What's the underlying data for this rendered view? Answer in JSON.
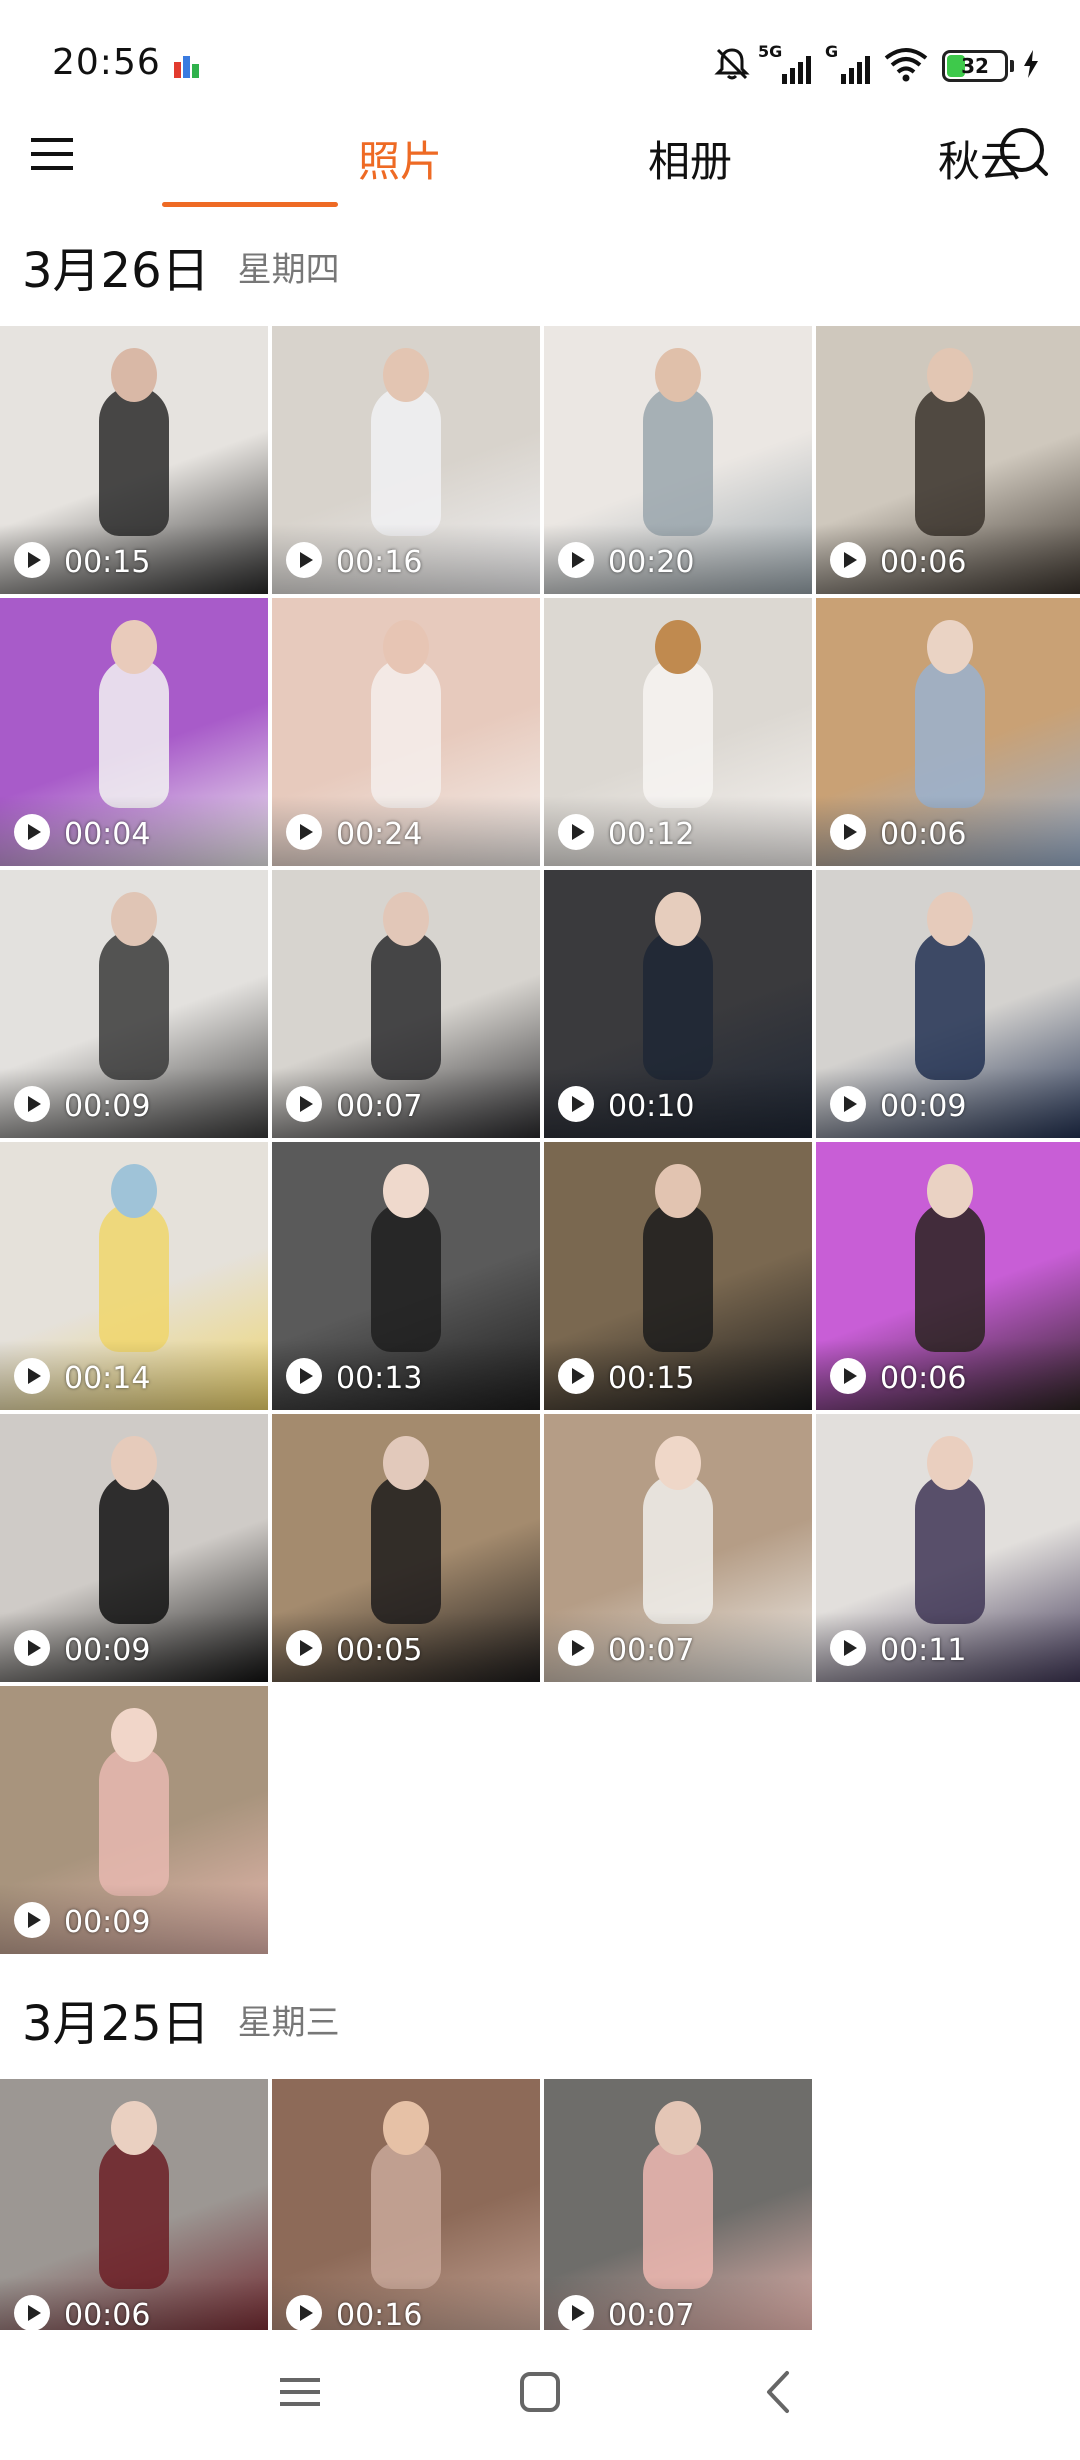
{
  "status_bar": {
    "time": "20:56",
    "network_1": "5G",
    "network_2": "G",
    "battery_level": "32",
    "battery_fraction": 0.32,
    "icons": [
      "app-notification-icon",
      "mute-bell-icon",
      "signal-5g-icon",
      "signal-g-icon",
      "wifi-icon",
      "battery-icon",
      "charging-bolt-icon"
    ]
  },
  "header": {
    "tabs": [
      {
        "label": "照片",
        "active": true
      },
      {
        "label": "相册",
        "active": false
      },
      {
        "label": "秋云",
        "active": false
      }
    ],
    "accent_color": "#ee6a24",
    "icons": [
      "menu-icon",
      "search-icon"
    ]
  },
  "sections": [
    {
      "date": "3月26日",
      "weekday": "星期四",
      "videos": [
        {
          "duration": "00:15"
        },
        {
          "duration": "00:16"
        },
        {
          "duration": "00:20"
        },
        {
          "duration": "00:06"
        },
        {
          "duration": "00:04"
        },
        {
          "duration": "00:24"
        },
        {
          "duration": "00:12"
        },
        {
          "duration": "00:06"
        },
        {
          "duration": "00:09"
        },
        {
          "duration": "00:07"
        },
        {
          "duration": "00:10"
        },
        {
          "duration": "00:09"
        },
        {
          "duration": "00:14"
        },
        {
          "duration": "00:13"
        },
        {
          "duration": "00:15"
        },
        {
          "duration": "00:06"
        },
        {
          "duration": "00:09"
        },
        {
          "duration": "00:05"
        },
        {
          "duration": "00:07"
        },
        {
          "duration": "00:11"
        },
        {
          "duration": "00:09"
        }
      ]
    },
    {
      "date": "3月25日",
      "weekday": "星期三",
      "videos": [
        {
          "duration": "00:06"
        },
        {
          "duration": "00:16"
        },
        {
          "duration": "00:07"
        }
      ]
    }
  ],
  "nav_bar": {
    "icons": [
      "recents-icon",
      "home-icon",
      "back-icon"
    ]
  }
}
